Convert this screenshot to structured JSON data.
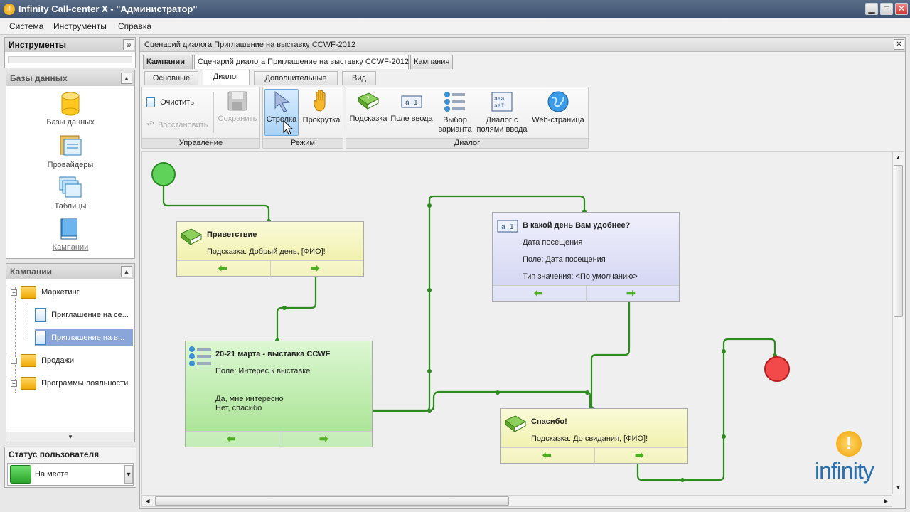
{
  "window": {
    "title": "Infinity Call-center X - \"Администратор\"",
    "minimize": "▁",
    "maximize": "□",
    "close": "✕"
  },
  "menu": [
    "Система",
    "Инструменты",
    "Справка"
  ],
  "tools": {
    "title": "Инструменты",
    "pin": "⊕"
  },
  "databases": {
    "title": "Базы данных",
    "items": [
      "Базы данных",
      "Провайдеры",
      "Таблицы",
      "Кампании"
    ]
  },
  "campaigns": {
    "title": "Кампании",
    "tree": [
      {
        "label": "Маркетинг"
      },
      {
        "label": "Приглашение на се..."
      },
      {
        "label": "Приглашение на в..."
      },
      {
        "label": "Продажи"
      },
      {
        "label": "Программы лояльности"
      }
    ]
  },
  "status": {
    "title": "Статус пользователя",
    "value": "На месте"
  },
  "doc": {
    "title": "Сценарий диалога Приглашение на выставку CCWF-2012",
    "tabs": [
      "Кампании",
      "Сценарий диалога Приглашение на выставку CCWF-2012",
      "Кампания"
    ]
  },
  "ribbon": {
    "tabs": [
      "Основные",
      "Диалог",
      "Дополнительные",
      "Вид"
    ],
    "groups": {
      "control": "Управление",
      "mode": "Режим",
      "dialog": "Диалог"
    },
    "buttons": {
      "clear": "Очистить",
      "restore": "Восстановить",
      "save": "Сохранить",
      "arrow": "Стрелка",
      "scroll": "Прокрутка",
      "hint": "Подсказка",
      "input": "Поле ввода",
      "choice": "Выбор варианта",
      "form": "Диалог с полями ввода",
      "web": "Web-страница"
    }
  },
  "nodes": {
    "greet": {
      "title": "Приветствие",
      "line1": "Подсказка: Добрый день, [ФИО]!"
    },
    "day": {
      "title": "В какой день Вам удобнее?",
      "line1": "Дата посещения",
      "line2": "Поле: Дата посещения",
      "line3": "Тип значения: <По умолчанию>"
    },
    "expo": {
      "title": "20-21 марта - выставка CCWF",
      "line1": "Поле: Интерес к выставке",
      "line2": "Да, мне интересно",
      "line3": "Нет, спасибо"
    },
    "thanks": {
      "title": "Спасибо!",
      "line1": "Подсказка: До свидания, [ФИО]!"
    }
  },
  "logo": "infinity"
}
